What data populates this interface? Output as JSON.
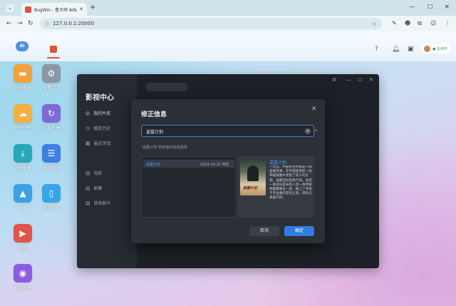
{
  "browser": {
    "tab_title": "BugWin - 鲁大师 AiNAS",
    "url": "127.0.0.1:20000"
  },
  "nas": {
    "logo_text": "AI",
    "user_status": "● 在线中"
  },
  "desktop": {
    "icons": [
      {
        "label": "文件管理",
        "icon": "folder-icon",
        "color": "#f2a23a"
      },
      {
        "label": "设置中心",
        "icon": "gear-icon",
        "color": "#8a96a6"
      },
      {
        "label": "WebDAV",
        "icon": "cloud-folder-icon",
        "color": "#f5b040"
      },
      {
        "label": "同期反馈",
        "icon": "refresh-icon",
        "color": "#7f6ad8"
      },
      {
        "label": "远程下载",
        "icon": "download-icon",
        "color": "#27a7b8"
      },
      {
        "label": "使用说明",
        "icon": "manual-icon",
        "color": "#3e7fe0"
      },
      {
        "label": "相册",
        "icon": "photo-icon",
        "color": "#3aa0e8"
      },
      {
        "label": "连接手机",
        "icon": "phone-icon",
        "color": "#36a6e6"
      },
      {
        "label": "影视",
        "icon": "play-icon",
        "color": "#e0554a"
      },
      {
        "label": "智能助理",
        "icon": "assistant-icon",
        "color": "#8b5be0"
      }
    ]
  },
  "app": {
    "title": "影视中心",
    "sidebar": [
      "我的片库",
      "播放历史",
      "最近添加",
      "电影",
      "剧集",
      "其他影片"
    ]
  },
  "modal": {
    "title": "修正信息",
    "search_value": "盗墓计划",
    "hint": "\"盗墓计划\"的检索内容请选择:",
    "results": [
      {
        "title": "盗墓计划",
        "date": "2024-10-22 电影"
      }
    ],
    "detail": {
      "title": "盗墓计划",
      "description": "一年前，中国考古界掀起一阵盗墓热潮，在中国某地区一处神秘陵墓中发现了惊人的文物，盗墓团伙趁机行动。此后一群身份各异的人因一张神秘地图聚集在一起，踏上了寻找千年古墓的冒险之旅，惊险与悬疑交织。"
    },
    "cancel_label": "取消",
    "ok_label": "确定"
  }
}
